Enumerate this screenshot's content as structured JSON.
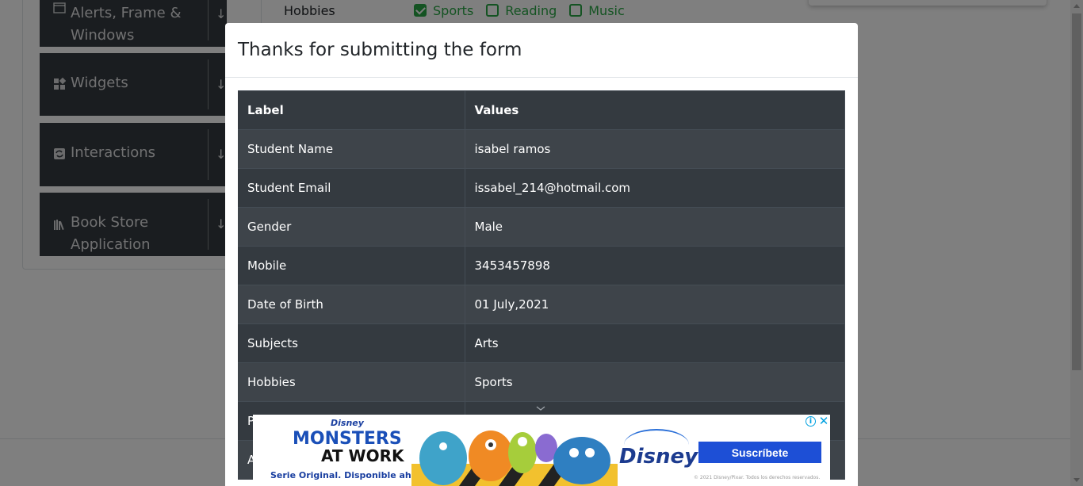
{
  "sidebar": {
    "groups": [
      {
        "label": "Alerts, Frame &\nWindows",
        "icon": "window-icon"
      },
      {
        "label": "Widgets",
        "icon": "widgets-icon"
      },
      {
        "label": "Interactions",
        "icon": "interactions-icon"
      },
      {
        "label": "Book Store\nApplication",
        "icon": "book-icon"
      }
    ]
  },
  "form_background": {
    "hobbies_label": "Hobbies",
    "hobbies": [
      {
        "label": "Sports",
        "checked": true
      },
      {
        "label": "Reading",
        "checked": false
      },
      {
        "label": "Music",
        "checked": false
      }
    ]
  },
  "modal": {
    "title": "Thanks for submitting the form",
    "table": {
      "headers": [
        "Label",
        "Values"
      ],
      "rows": [
        [
          "Student Name",
          "isabel ramos"
        ],
        [
          "Student Email",
          "issabel_214@hotmail.com"
        ],
        [
          "Gender",
          "Male"
        ],
        [
          "Mobile",
          "3453457898"
        ],
        [
          "Date of Birth",
          "01 July,2021"
        ],
        [
          "Subjects",
          "Arts"
        ],
        [
          "Hobbies",
          "Sports"
        ],
        [
          "P",
          ""
        ],
        [
          "A",
          ""
        ]
      ]
    }
  },
  "ad": {
    "brand": "Disney",
    "title_line1": "MONSTERS",
    "title_line2": "AT WORK",
    "tagline": "Serie Original. Disponible ahora.",
    "service": "Disney+",
    "cta": "Suscríbete",
    "legal": "© 2021 Disney/Pixar. Todos los derechos reservados."
  },
  "colors": {
    "sidebar_bg": "#343a40",
    "check_green": "#28a745",
    "table_dark": "#343a40",
    "table_stripe": "#3e444a",
    "ad_cta": "#1d4fd6",
    "ad_blue": "#1a4fb8"
  }
}
